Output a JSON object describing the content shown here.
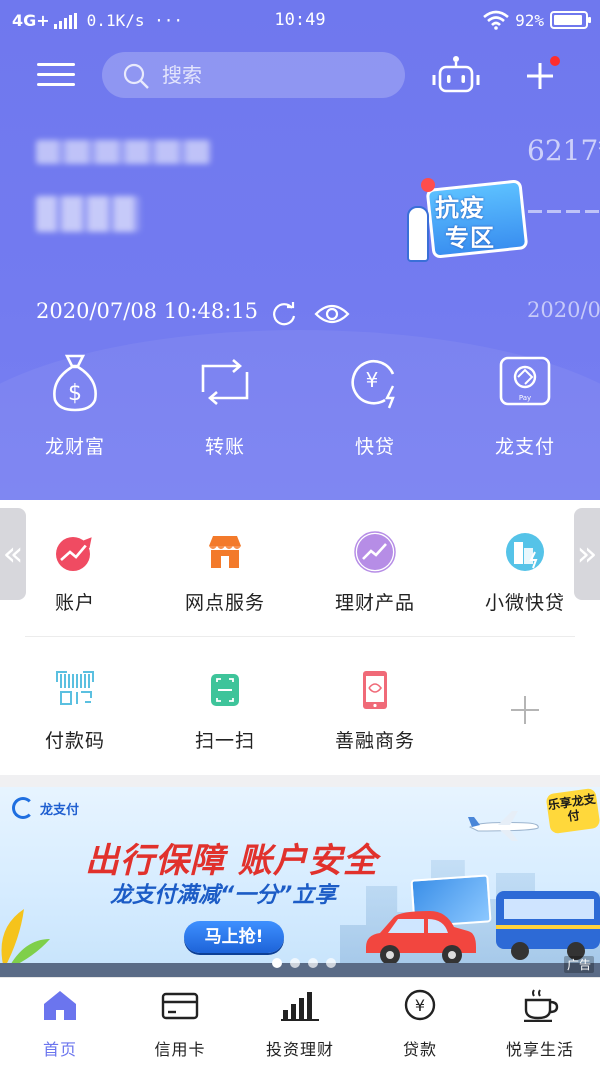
{
  "colors": {
    "header": "#737bf0",
    "accent_active": "#6b75ee",
    "notification_dot": "#ff2d2d",
    "banner_headline": "#e1312c"
  },
  "status_bar": {
    "network": "4G+",
    "speed": "0.1K/s ···",
    "time": "10:49",
    "battery": "92%",
    "battery_level": 0.92
  },
  "header": {
    "search_placeholder": "搜索",
    "icons": [
      "menu-icon",
      "search-icon",
      "robot-icon",
      "plus-icon"
    ],
    "card_number_partial": "6217*",
    "timestamp": "2020/07/08 10:48:15",
    "card_date_partial": "2020/0",
    "promo": {
      "line1": "抗疫",
      "line2": "专区"
    }
  },
  "quick_actions": [
    {
      "label": "龙财富",
      "icon": "money-bag-icon"
    },
    {
      "label": "转账",
      "icon": "transfer-icon"
    },
    {
      "label": "快贷",
      "icon": "quick-loan-icon"
    },
    {
      "label": "龙支付",
      "icon": "pay-icon"
    }
  ],
  "services": {
    "row1": [
      {
        "label": "账户",
        "icon": "account-icon"
      },
      {
        "label": "网点服务",
        "icon": "branch-icon"
      },
      {
        "label": "理财产品",
        "icon": "finance-icon"
      },
      {
        "label": "小微快贷",
        "icon": "sme-loan-icon"
      }
    ],
    "row2": [
      {
        "label": "付款码",
        "icon": "payment-code-icon"
      },
      {
        "label": "扫一扫",
        "icon": "scan-icon"
      },
      {
        "label": "善融商务",
        "icon": "ecommerce-icon"
      }
    ],
    "left_arrow": "«",
    "right_arrow": "»"
  },
  "banner": {
    "brand": "龙支付",
    "headline": "出行保障 账户安全",
    "subline": "龙支付满减“一分”立享",
    "cta": "马上抢!",
    "badge": "乐享龙支付",
    "ad_label": "广告"
  },
  "tabbar": [
    {
      "label": "首页",
      "icon": "home-icon",
      "active": true
    },
    {
      "label": "信用卡",
      "icon": "credit-card-icon",
      "active": false
    },
    {
      "label": "投资理财",
      "icon": "chart-bars-icon",
      "active": false
    },
    {
      "label": "贷款",
      "icon": "yuan-coin-icon",
      "active": false
    },
    {
      "label": "悦享生活",
      "icon": "coffee-cup-icon",
      "active": false
    }
  ]
}
